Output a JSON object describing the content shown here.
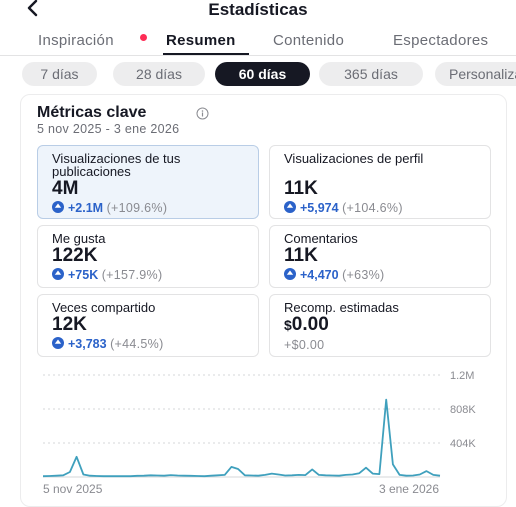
{
  "header": {
    "title": "Estadísticas",
    "back_icon": "chevron-left-icon"
  },
  "tabs": [
    {
      "label": "Inspiración",
      "has_notification": true
    },
    {
      "label": "Resumen",
      "active": true
    },
    {
      "label": "Contenido"
    },
    {
      "label": "Espectadores"
    }
  ],
  "ranges": [
    {
      "label": "7 días"
    },
    {
      "label": "28 días"
    },
    {
      "label": "60 días",
      "active": true
    },
    {
      "label": "365 días"
    },
    {
      "label": "Personalizado"
    }
  ],
  "metrics_card": {
    "title": "Métricas clave",
    "info_icon": "info-icon",
    "date_range": "5 nov 2025 - 3 ene 2026",
    "metrics": [
      {
        "label": "Visualizaciones de tus publicaciones",
        "value": "4M",
        "delta": "+2.1M",
        "percent": "(+109.6%)",
        "selected": true
      },
      {
        "label": "Visualizaciones de perfil",
        "value": "11K",
        "delta": "+5,974",
        "percent": "(+104.6%)"
      },
      {
        "label": "Me gusta",
        "value": "122K",
        "delta": "+75K",
        "percent": "(+157.9%)"
      },
      {
        "label": "Comentarios",
        "value": "11K",
        "delta": "+4,470",
        "percent": "(+63%)"
      },
      {
        "label": "Veces compartido",
        "value": "12K",
        "delta": "+3,783",
        "percent": "(+44.5%)"
      },
      {
        "label": "Recomp. estimadas",
        "value_currency": "$",
        "value": "0.00",
        "change_text": "+$0.00"
      }
    ]
  },
  "colors": {
    "accent": "#2b62c9",
    "notification": "#fe2c55",
    "selected_card": "#eef4fb",
    "line": "#3fa0bd"
  },
  "chart_data": {
    "type": "line",
    "x_start_label": "5 nov 2025",
    "x_end_label": "3 ene 2026",
    "y_ticks": [
      "1.2M",
      "808K",
      "404K"
    ],
    "ylim": [
      0,
      1212000
    ],
    "grid": true,
    "series": [
      {
        "values": [
          10000,
          12000,
          15000,
          20000,
          60000,
          240000,
          30000,
          15000,
          12000,
          10000,
          9000,
          10000,
          9000,
          10000,
          14000,
          16000,
          20000,
          18000,
          15000,
          22000,
          18000,
          15000,
          14000,
          12000,
          10000,
          16000,
          20000,
          25000,
          120000,
          95000,
          20000,
          18000,
          15000,
          25000,
          40000,
          30000,
          18000,
          20000,
          25000,
          22000,
          90000,
          25000,
          20000,
          18000,
          16000,
          25000,
          30000,
          45000,
          110000,
          40000,
          35000,
          920000,
          150000,
          25000,
          15000,
          18000,
          30000,
          70000,
          25000,
          15000
        ]
      }
    ]
  }
}
